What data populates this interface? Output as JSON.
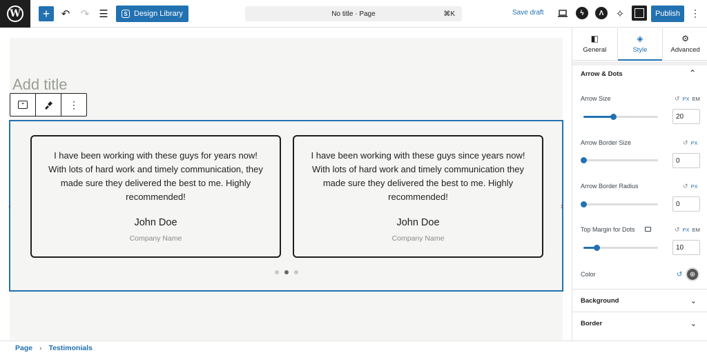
{
  "topbar": {
    "design_library_label": "Design Library",
    "document_title": "No title · Page",
    "shortcut": "⌘K",
    "save_draft_label": "Save draft",
    "publish_label": "Publish"
  },
  "canvas": {
    "title_placeholder": "Add title",
    "testimonials": [
      {
        "quote": "I have been working with these guys for years now! With lots of hard work and timely communication, they made sure they delivered the best to me. Highly recommended!",
        "name": "John Doe",
        "company": "Company Name"
      },
      {
        "quote": "I have been working with these guys since years now! With lots of hard work and timely communication they made sure they delivered the best to me. Highly recommended!",
        "name": "John Doe",
        "company": "Company Name"
      }
    ],
    "dots_total": 3,
    "active_dot": 2
  },
  "breadcrumb": {
    "items": [
      "Page",
      "Testimonials"
    ],
    "separator": "›"
  },
  "sidebar": {
    "tabs": [
      {
        "label": "General",
        "icon": "layout-icon"
      },
      {
        "label": "Style",
        "icon": "paint-bucket-icon"
      },
      {
        "label": "Advanced",
        "icon": "gear-icon"
      }
    ],
    "active_tab": "Style",
    "section_title": "Arrow & Dots",
    "controls": [
      {
        "label": "Arrow Size",
        "value": "20",
        "units": [
          "PX",
          "EM"
        ],
        "slider_percent": 40
      },
      {
        "label": "Arrow Border Size",
        "value": "0",
        "units": [
          "PX"
        ],
        "slider_percent": 0
      },
      {
        "label": "Arrow Border Radius",
        "value": "0",
        "units": [
          "PX"
        ],
        "slider_percent": 0
      },
      {
        "label": "Top Margin for Dots",
        "value": "10",
        "units": [
          "PX",
          "EM"
        ],
        "slider_percent": 18
      }
    ],
    "color_label": "Color",
    "collapsed_sections": [
      "Background",
      "Border"
    ]
  },
  "colors": {
    "accent": "#2271b1",
    "dark": "#1e1e1e",
    "canvas_bg": "#f5f5f3"
  }
}
